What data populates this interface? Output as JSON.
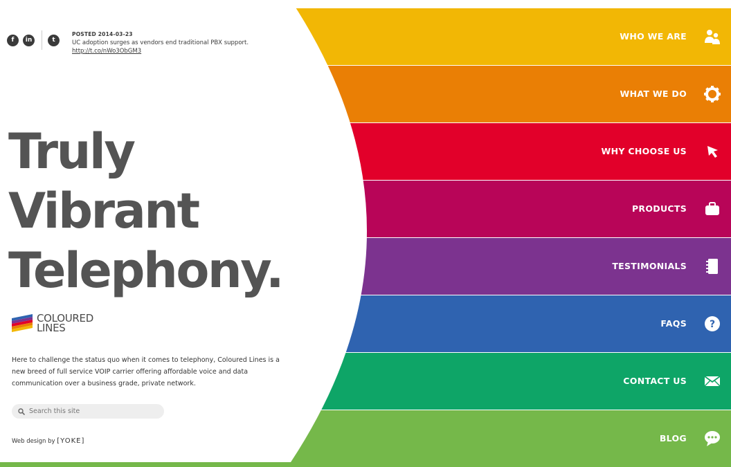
{
  "tweet": {
    "posted": "POSTED 2014-03-23",
    "text": "UC adoption surges as vendors end traditional PBX support.",
    "link": "http://t.co/nWo3ObGM3"
  },
  "social": [
    {
      "icon": "facebook-icon",
      "glyph": "f"
    },
    {
      "icon": "linkedin-icon",
      "glyph": "in"
    },
    {
      "icon": "twitter-icon",
      "glyph": "t"
    }
  ],
  "headline": [
    "Truly",
    "Vibrant",
    "Telephony."
  ],
  "logo": {
    "line1": "COLOURED",
    "line2": "LINES"
  },
  "intro": "Here to challenge the status quo when it comes to telephony, Coloured Lines is a new breed of full service VOIP carrier offering affordable voice and data communication over a business grade, private network.",
  "search": {
    "placeholder": "Search this site"
  },
  "credit": {
    "prefix": "Web design by",
    "brand": "[YOKE]"
  },
  "nav": [
    {
      "label": "WHO WE ARE",
      "color": "#f2b705",
      "icon": "people-icon"
    },
    {
      "label": "WHAT WE DO",
      "color": "#ea7f05",
      "icon": "gear-icon"
    },
    {
      "label": "WHY CHOOSE US",
      "color": "#e2002a",
      "icon": "cursor-icon"
    },
    {
      "label": "PRODUCTS",
      "color": "#b80558",
      "icon": "briefcase-icon"
    },
    {
      "label": "TESTIMONIALS",
      "color": "#7c338f",
      "icon": "notebook-icon"
    },
    {
      "label": "FAQS",
      "color": "#2f63b0",
      "icon": "question-icon"
    },
    {
      "label": "CONTACT US",
      "color": "#0ea567",
      "icon": "envelope-icon"
    },
    {
      "label": "BLOG",
      "color": "#75b84a",
      "icon": "chat-bubble-icon"
    }
  ]
}
